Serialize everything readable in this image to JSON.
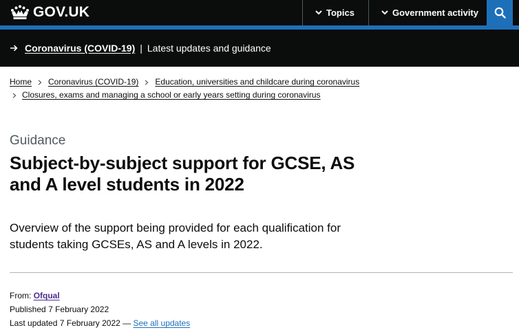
{
  "header": {
    "logo_text": "GOV.UK",
    "nav": [
      {
        "label": "Topics"
      },
      {
        "label": "Government activity"
      }
    ],
    "search_icon": "search-icon",
    "brand_colors": {
      "black": "#0b0c0c",
      "blue": "#1d70b8"
    }
  },
  "covid_banner": {
    "link_text": "Coronavirus (COVID-19)",
    "separator": "|",
    "description": "Latest updates and guidance"
  },
  "breadcrumbs": {
    "items": [
      {
        "label": "Home"
      },
      {
        "label": "Coronavirus (COVID-19)"
      },
      {
        "label": "Education, universities and childcare during coronavirus"
      },
      {
        "label": "Closures, exams and managing a school or early years setting during coronavirus"
      }
    ]
  },
  "main": {
    "caption": "Guidance",
    "title": "Subject-by-subject support for GCSE, AS and A level students in 2022",
    "lede": "Overview of the support being provided for each qualification for students taking GCSEs, AS and A levels in 2022."
  },
  "metadata": {
    "from_label": "From:",
    "from_org": "Ofqual",
    "published_label": "Published",
    "published_date": "7 February 2022",
    "updated_label": "Last updated",
    "updated_date": "7 February 2022",
    "updated_dash": "—",
    "see_all_updates": "See all updates"
  }
}
